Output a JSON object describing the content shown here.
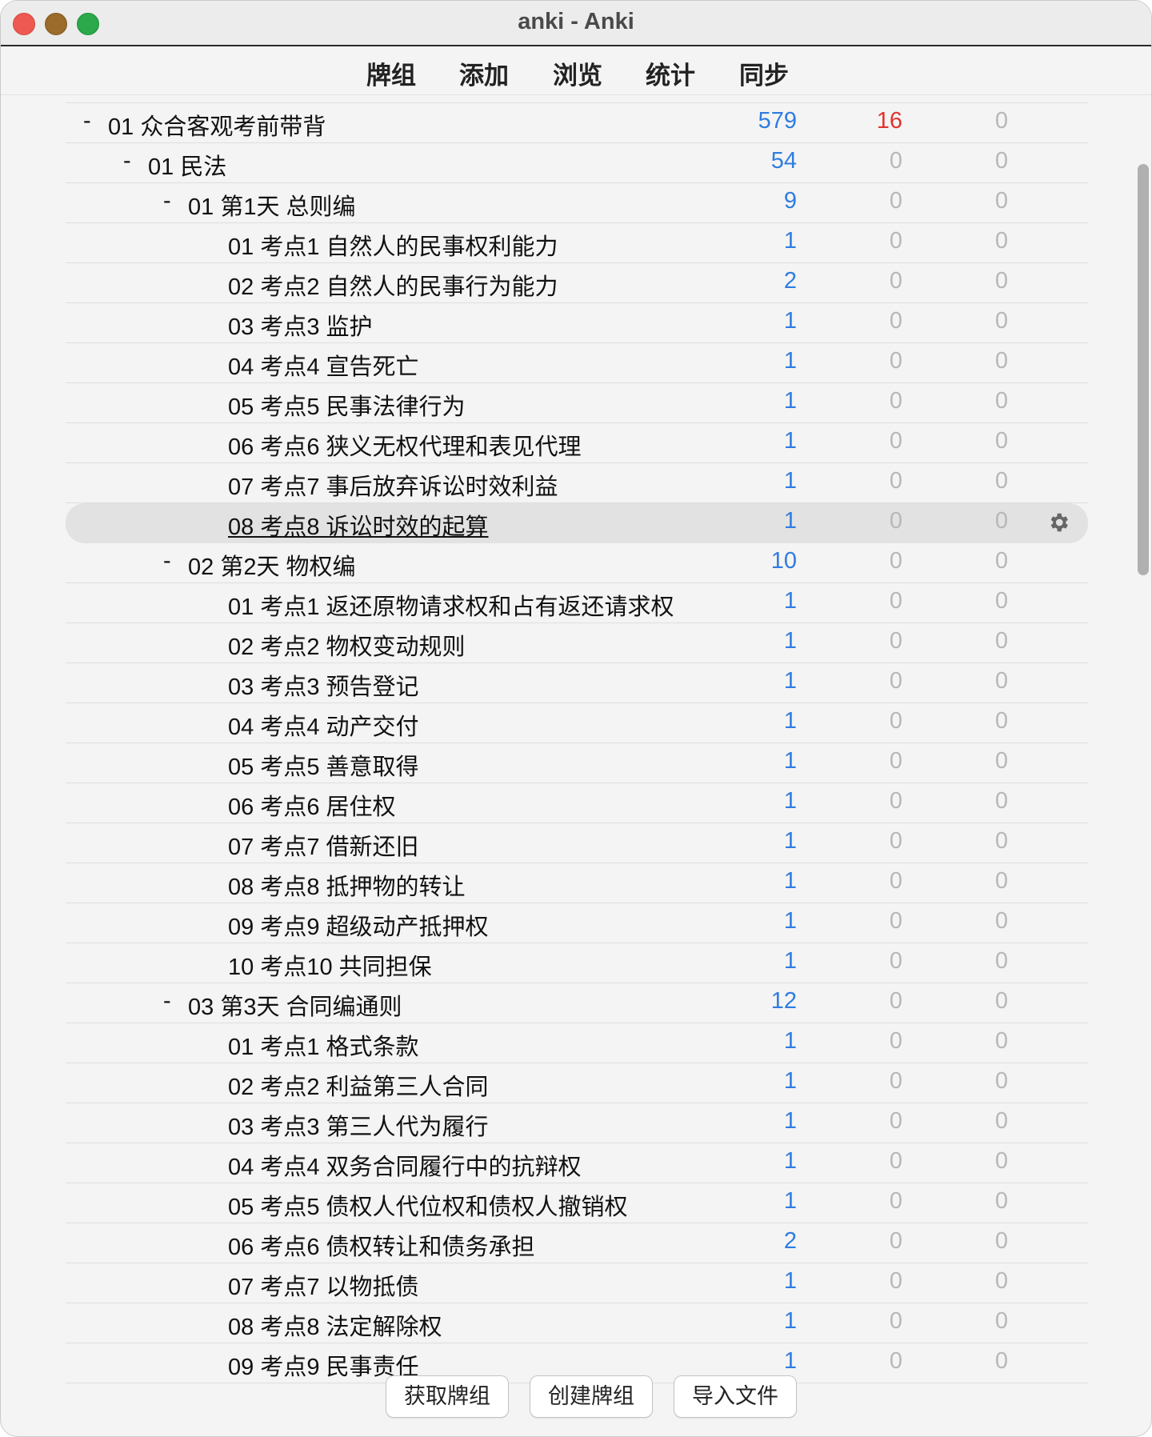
{
  "window": {
    "title": "anki - Anki"
  },
  "toolbar": {
    "decks": "牌组",
    "add": "添加",
    "browse": "浏览",
    "stats": "统计",
    "sync": "同步"
  },
  "rows": [
    {
      "collapse": "-",
      "name": "01 众合客观考前带背",
      "new": "579",
      "learn": "16",
      "due": "0",
      "level": 0
    },
    {
      "collapse": "-",
      "name": "01 民法",
      "new": "54",
      "learn": "0",
      "due": "0",
      "level": 1
    },
    {
      "collapse": "-",
      "name": "01 第1天 总则编",
      "new": "9",
      "learn": "0",
      "due": "0",
      "level": 2
    },
    {
      "collapse": "",
      "name": "01 考点1 自然人的民事权利能力",
      "new": "1",
      "learn": "0",
      "due": "0",
      "level": 3
    },
    {
      "collapse": "",
      "name": "02 考点2 自然人的民事行为能力",
      "new": "2",
      "learn": "0",
      "due": "0",
      "level": 3
    },
    {
      "collapse": "",
      "name": "03 考点3 监护",
      "new": "1",
      "learn": "0",
      "due": "0",
      "level": 3
    },
    {
      "collapse": "",
      "name": "04 考点4 宣告死亡",
      "new": "1",
      "learn": "0",
      "due": "0",
      "level": 3
    },
    {
      "collapse": "",
      "name": "05 考点5 民事法律行为",
      "new": "1",
      "learn": "0",
      "due": "0",
      "level": 3
    },
    {
      "collapse": "",
      "name": "06 考点6 狭义无权代理和表见代理",
      "new": "1",
      "learn": "0",
      "due": "0",
      "level": 3
    },
    {
      "collapse": "",
      "name": "07 考点7 事后放弃诉讼时效利益",
      "new": "1",
      "learn": "0",
      "due": "0",
      "level": 3
    },
    {
      "collapse": "",
      "name": "08 考点8 诉讼时效的起算",
      "new": "1",
      "learn": "0",
      "due": "0",
      "level": 3
    },
    {
      "collapse": "-",
      "name": "02 第2天 物权编",
      "new": "10",
      "learn": "0",
      "due": "0",
      "level": 2
    },
    {
      "collapse": "",
      "name": "01 考点1 返还原物请求权和占有返还请求权",
      "new": "1",
      "learn": "0",
      "due": "0",
      "level": 3
    },
    {
      "collapse": "",
      "name": "02 考点2 物权变动规则",
      "new": "1",
      "learn": "0",
      "due": "0",
      "level": 3
    },
    {
      "collapse": "",
      "name": "03 考点3 预告登记",
      "new": "1",
      "learn": "0",
      "due": "0",
      "level": 3
    },
    {
      "collapse": "",
      "name": "04 考点4 动产交付",
      "new": "1",
      "learn": "0",
      "due": "0",
      "level": 3
    },
    {
      "collapse": "",
      "name": "05 考点5 善意取得",
      "new": "1",
      "learn": "0",
      "due": "0",
      "level": 3
    },
    {
      "collapse": "",
      "name": "06 考点6 居住权",
      "new": "1",
      "learn": "0",
      "due": "0",
      "level": 3
    },
    {
      "collapse": "",
      "name": "07 考点7 借新还旧",
      "new": "1",
      "learn": "0",
      "due": "0",
      "level": 3
    },
    {
      "collapse": "",
      "name": "08 考点8 抵押物的转让",
      "new": "1",
      "learn": "0",
      "due": "0",
      "level": 3
    },
    {
      "collapse": "",
      "name": "09 考点9 超级动产抵押权",
      "new": "1",
      "learn": "0",
      "due": "0",
      "level": 3
    },
    {
      "collapse": "",
      "name": "10 考点10 共同担保",
      "new": "1",
      "learn": "0",
      "due": "0",
      "level": 3
    },
    {
      "collapse": "-",
      "name": "03 第3天 合同编通则",
      "new": "12",
      "learn": "0",
      "due": "0",
      "level": 2
    },
    {
      "collapse": "",
      "name": "01 考点1 格式条款",
      "new": "1",
      "learn": "0",
      "due": "0",
      "level": 3
    },
    {
      "collapse": "",
      "name": "02 考点2 利益第三人合同",
      "new": "1",
      "learn": "0",
      "due": "0",
      "level": 3
    },
    {
      "collapse": "",
      "name": "03 考点3 第三人代为履行",
      "new": "1",
      "learn": "0",
      "due": "0",
      "level": 3
    },
    {
      "collapse": "",
      "name": "04 考点4 双务合同履行中的抗辩权",
      "new": "1",
      "learn": "0",
      "due": "0",
      "level": 3
    },
    {
      "collapse": "",
      "name": "05 考点5 债权人代位权和债权人撤销权",
      "new": "1",
      "learn": "0",
      "due": "0",
      "level": 3
    },
    {
      "collapse": "",
      "name": "06 考点6 债权转让和债务承担",
      "new": "2",
      "learn": "0",
      "due": "0",
      "level": 3
    },
    {
      "collapse": "",
      "name": "07 考点7 以物抵债",
      "new": "1",
      "learn": "0",
      "due": "0",
      "level": 3
    },
    {
      "collapse": "",
      "name": "08 考点8 法定解除权",
      "new": "1",
      "learn": "0",
      "due": "0",
      "level": 3
    },
    {
      "collapse": "",
      "name": "09 考点9 民事责任",
      "new": "1",
      "learn": "0",
      "due": "0",
      "level": 3
    }
  ],
  "highlighted_row": 10,
  "colors": {
    "new": "#2e7de0",
    "learn_active": "#e0352e",
    "zero": "#b8b8b8"
  },
  "icons": {
    "options": "gear-icon"
  },
  "bottom_buttons": {
    "get_shared": "获取牌组",
    "create_deck": "创建牌组",
    "import_file": "导入文件"
  }
}
